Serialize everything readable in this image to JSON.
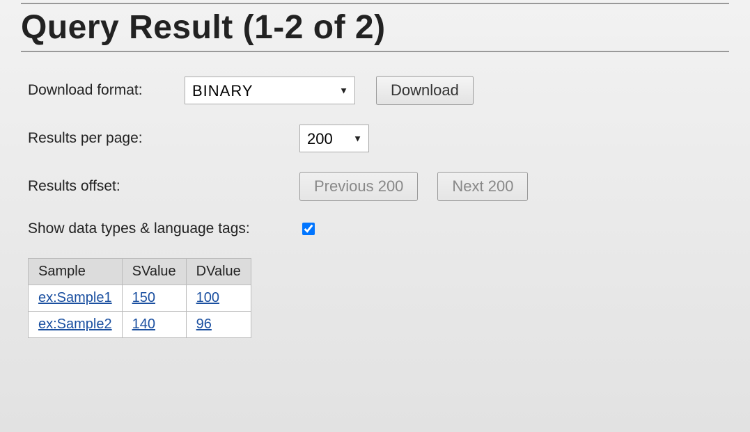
{
  "page_title": "Query Result (1-2 of 2)",
  "download": {
    "label": "Download format:",
    "selected": "BINARY",
    "button": "Download"
  },
  "perpage": {
    "label": "Results per page:",
    "selected": "200"
  },
  "offset": {
    "label": "Results offset:",
    "prev": "Previous 200",
    "next": "Next 200"
  },
  "showtypes": {
    "label": "Show data types & language tags:",
    "checked": true
  },
  "table": {
    "headers": [
      "Sample",
      "SValue",
      "DValue"
    ],
    "rows": [
      {
        "Sample": "ex:Sample1",
        "SValue": "150",
        "DValue": "100"
      },
      {
        "Sample": "ex:Sample2",
        "SValue": "140",
        "DValue": "96"
      }
    ]
  }
}
